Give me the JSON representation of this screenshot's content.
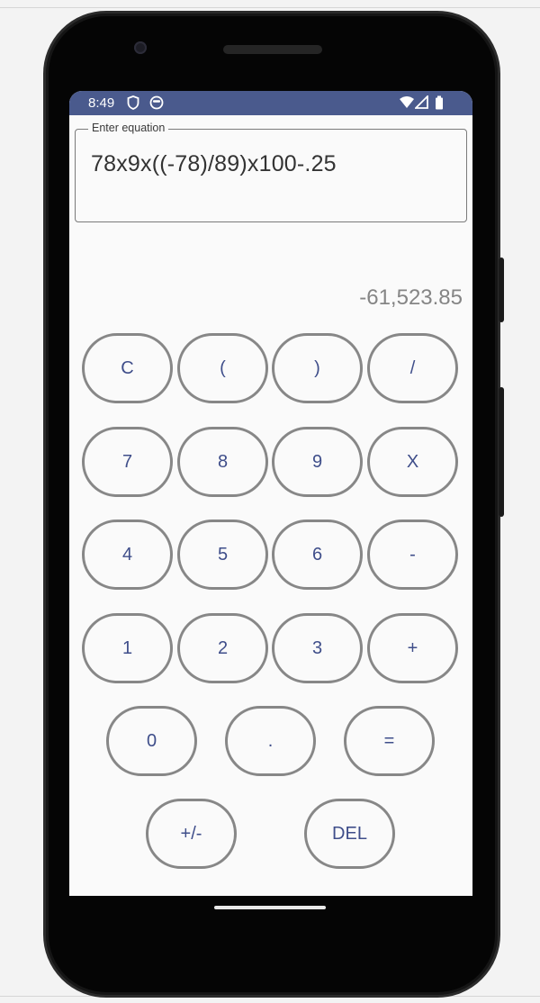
{
  "status_bar": {
    "time": "8:49",
    "icons": [
      "shield-icon",
      "face-icon",
      "wifi-icon",
      "signal-icon",
      "battery-icon"
    ]
  },
  "equation_field": {
    "label": "Enter equation",
    "value": "78x9x((-78)/89)x100-.25"
  },
  "result": "-61,523.85",
  "keypad": {
    "row1": [
      "C",
      "(",
      ")",
      "/"
    ],
    "row2": [
      "7",
      "8",
      "9",
      "X"
    ],
    "row3": [
      "4",
      "5",
      "6",
      "-"
    ],
    "row4": [
      "1",
      "2",
      "3",
      "+"
    ],
    "row5": [
      "0",
      ".",
      "="
    ],
    "row6": [
      "+/-",
      "DEL"
    ]
  },
  "colors": {
    "status_bar": "#4a5a8d",
    "key_text": "#3f4e8a",
    "key_border": "#878787",
    "result_text": "#858585"
  }
}
